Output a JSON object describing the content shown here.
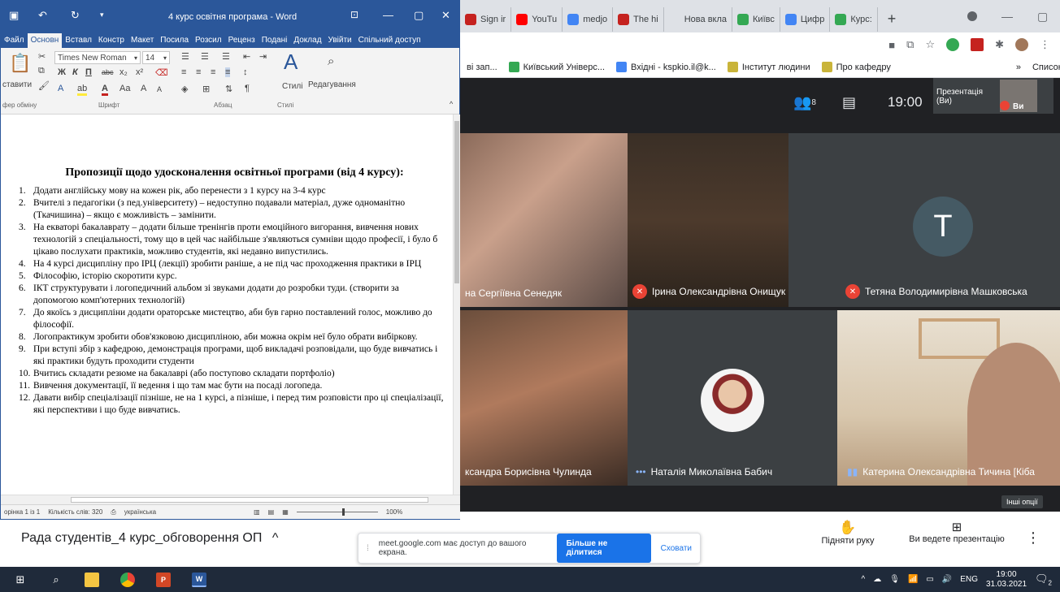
{
  "word": {
    "title": "4 курс освітня програма - Word",
    "tabs": [
      "Файл",
      "Основн",
      "Вставл",
      "Констр",
      "Макет",
      "Посила",
      "Розсил",
      "Реценз",
      "Подані",
      "Доклад",
      "Увійти",
      "Спільний доступ"
    ],
    "font_name": "Times New Roman",
    "font_size": "14",
    "paste_label": "ставити",
    "styles_label": "Стилі",
    "editing_label": "Редагування",
    "groups": [
      "фер обміну",
      "Шрифт",
      "Абзац",
      "Стилі"
    ],
    "heading": "Пропозиції щодо удосконалення освітньої програми (від 4 курсу):",
    "items": [
      {
        "num": "1.",
        "text": "Додати англійську мову на кожен рік, або перенести з 1 курсу на 3-4 курс"
      },
      {
        "num": "2.",
        "text": "Вчителі з педагогіки (з пед.університету) – недоступно подавали матеріал, дуже одноманітно (Ткачишина) – якщо є можливість – замінити."
      },
      {
        "num": "3.",
        "text": "На екваторі бакалаврату – додати більше тренінгів проти емоційного вигорання, вивчення нових технологій з спеціальності, тому що в цей час найбільше з'являються сумніви щодо професії, і було б цікаво послухати практиків, можливо студентів, які недавно випустились."
      },
      {
        "num": "4.",
        "text": "На 4 курсі дисципліну про ІРЦ (лекції) зробити раніше, а не під час проходження практики в ІРЦ"
      },
      {
        "num": "5.",
        "text": "Філософію, історію скоротити курс."
      },
      {
        "num": "6.",
        "text": "ІКТ структурувати і логопедичний альбом зі звуками додати до розробки туди. (створити за допомогою комп'ютерних технологій)"
      },
      {
        "num": "7.",
        "text": "До якоїсь з дисципліни додати ораторське мистецтво, аби був гарно поставлений голос, можливо до філософії."
      },
      {
        "num": "8.",
        "text": "Логопрактикум зробити обов'язковою дисципліною, аби можна окрім неї було обрати вибіркову."
      },
      {
        "num": "9.",
        "text": "При вступі збір з кафедрою, демонстрація програми, щоб викладачі розповідали, що буде вивчатись і які практики будуть проходити студенти"
      },
      {
        "num": "10.",
        "text": "Вчитись складати резюме на бакалаврі (або поступово складати портфоліо)"
      },
      {
        "num": "11.",
        "text": "Вивчення документації, її ведення і що там має бути на посаді логопеда."
      },
      {
        "num": "12.",
        "text": "Давати вибір спеціалізації пізніше, не на 1 курсі, а пізніше, і перед тим розповісти про ці спеціалізації, які перспективи і що буде вивчатись."
      }
    ],
    "status": {
      "page": "орінка 1 із 1",
      "words": "Кількість слів: 320",
      "lang": "українська",
      "zoom": "100%"
    }
  },
  "chrome": {
    "tabs": [
      {
        "label": "Sign ir",
        "color": "#c5221f"
      },
      {
        "label": "YouTu",
        "color": "#ff0000"
      },
      {
        "label": "medjo",
        "color": "#4285f4"
      },
      {
        "label": "The hi",
        "color": "#c5221f"
      },
      {
        "label": "Нова вкла",
        "color": ""
      },
      {
        "label": "Київс",
        "color": "#34a853"
      },
      {
        "label": "Цифр",
        "color": "#4285f4"
      },
      {
        "label": "Курс:",
        "color": "#34a853"
      }
    ],
    "bookmarks": [
      {
        "label": "ві зап...",
        "color": ""
      },
      {
        "label": "Київський Універс...",
        "color": "#34a853"
      },
      {
        "label": "Вхідні - kspkio.il@k...",
        "color": "#4285f4"
      },
      {
        "label": "Інститут людини",
        "color": "#c9b43a"
      },
      {
        "label": "Про кафедру",
        "color": "#c9b43a"
      },
      {
        "label": "»",
        "color": ""
      },
      {
        "label": "Список читання",
        "color": ""
      }
    ]
  },
  "meet": {
    "participants_count": "8",
    "time": "19:00",
    "pip_label": "Презентація (Ви)",
    "pip_you": "Ви",
    "tiles": [
      {
        "name": "на Сергіївна Сенедяк",
        "muted": false
      },
      {
        "name": "Ірина Олександрівна Онищук",
        "muted": true
      },
      {
        "name": "Тетяна Володимирівна Машковська",
        "muted": true,
        "initial": "T"
      },
      {
        "name": "ксандра Борисівна Чулинда",
        "muted": false
      },
      {
        "name": "Наталія Миколаївна Бабич",
        "muted": false
      },
      {
        "name": "Катерина Олександрівна Тичина [Кіба",
        "muted": false
      }
    ],
    "more_options": "Інші опції",
    "meeting_title": "Рада студентів_4 курс_обговорення ОП",
    "raise_hand": "Підняти руку",
    "presenting": "Ви ведете презентацію",
    "share_banner": {
      "text": "meet.google.com має доступ до вашого екрана.",
      "stop": "Більше не ділитися",
      "hide": "Сховати"
    }
  },
  "taskbar": {
    "lang": "ENG",
    "time": "19:00",
    "date": "31.03.2021",
    "notif": "2"
  }
}
